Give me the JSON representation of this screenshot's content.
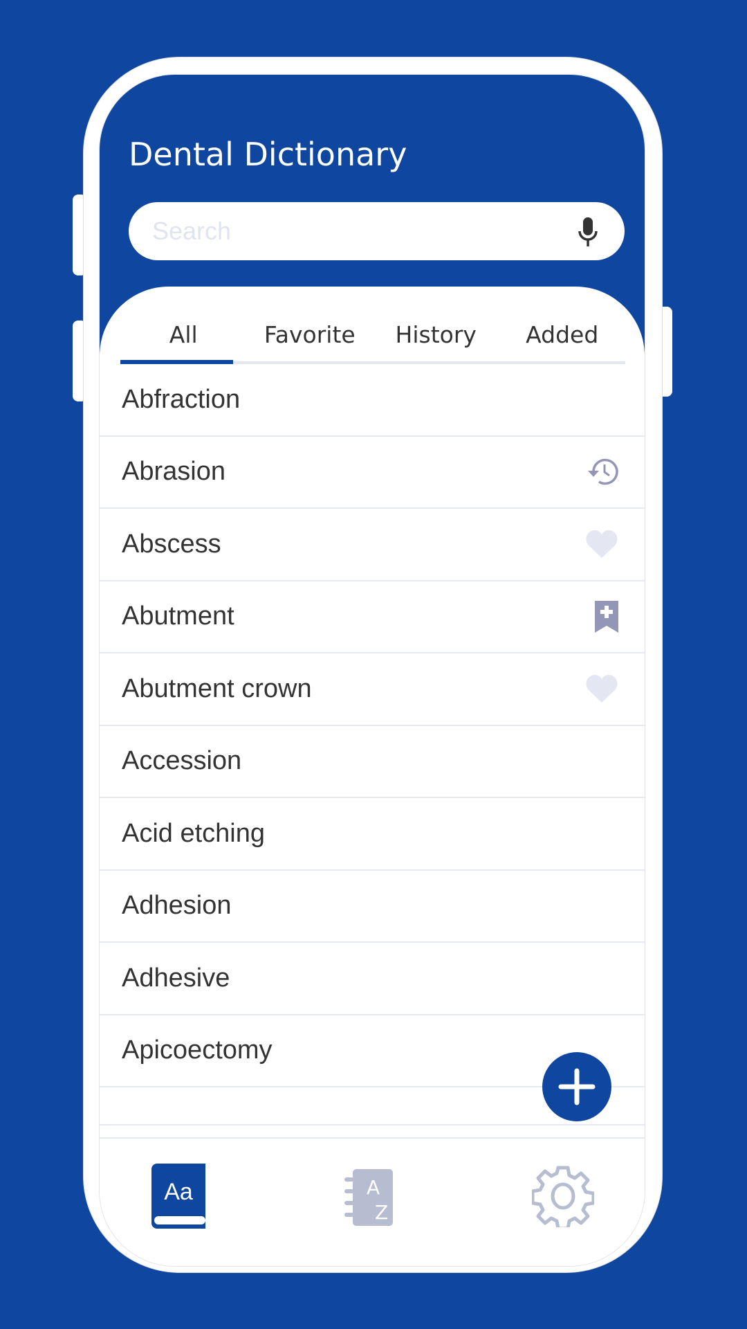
{
  "app": {
    "title": "Dental Dictionary"
  },
  "search": {
    "placeholder": "Search",
    "value": ""
  },
  "tabs": [
    {
      "label": "All",
      "active": true
    },
    {
      "label": "Favorite"
    },
    {
      "label": "History"
    },
    {
      "label": "Added"
    }
  ],
  "words": [
    {
      "term": "Abfraction",
      "icon": ""
    },
    {
      "term": "Abrasion",
      "icon": "history-icon"
    },
    {
      "term": "Abscess",
      "icon": "heart-icon"
    },
    {
      "term": "Abutment",
      "icon": "bookmark-add-icon"
    },
    {
      "term": "Abutment crown",
      "icon": "heart-icon"
    },
    {
      "term": "Accession",
      "icon": ""
    },
    {
      "term": "Acid etching",
      "icon": ""
    },
    {
      "term": "Adhesion",
      "icon": ""
    },
    {
      "term": "Adhesive",
      "icon": ""
    },
    {
      "term": "Apicoectomy",
      "icon": ""
    },
    {
      "term": "",
      "icon": ""
    }
  ],
  "nav": {
    "items": [
      {
        "icon": "dictionary-icon",
        "label": "Aa",
        "active": true
      },
      {
        "icon": "a-z-index-icon",
        "label_a": "A",
        "label_z": "Z"
      },
      {
        "icon": "settings-icon"
      }
    ]
  },
  "colors": {
    "primary": "#0f47a0",
    "icon_gray": "#9396b6",
    "heart_light": "#e4e6f2",
    "nav_inactive": "#b7bdd0"
  }
}
